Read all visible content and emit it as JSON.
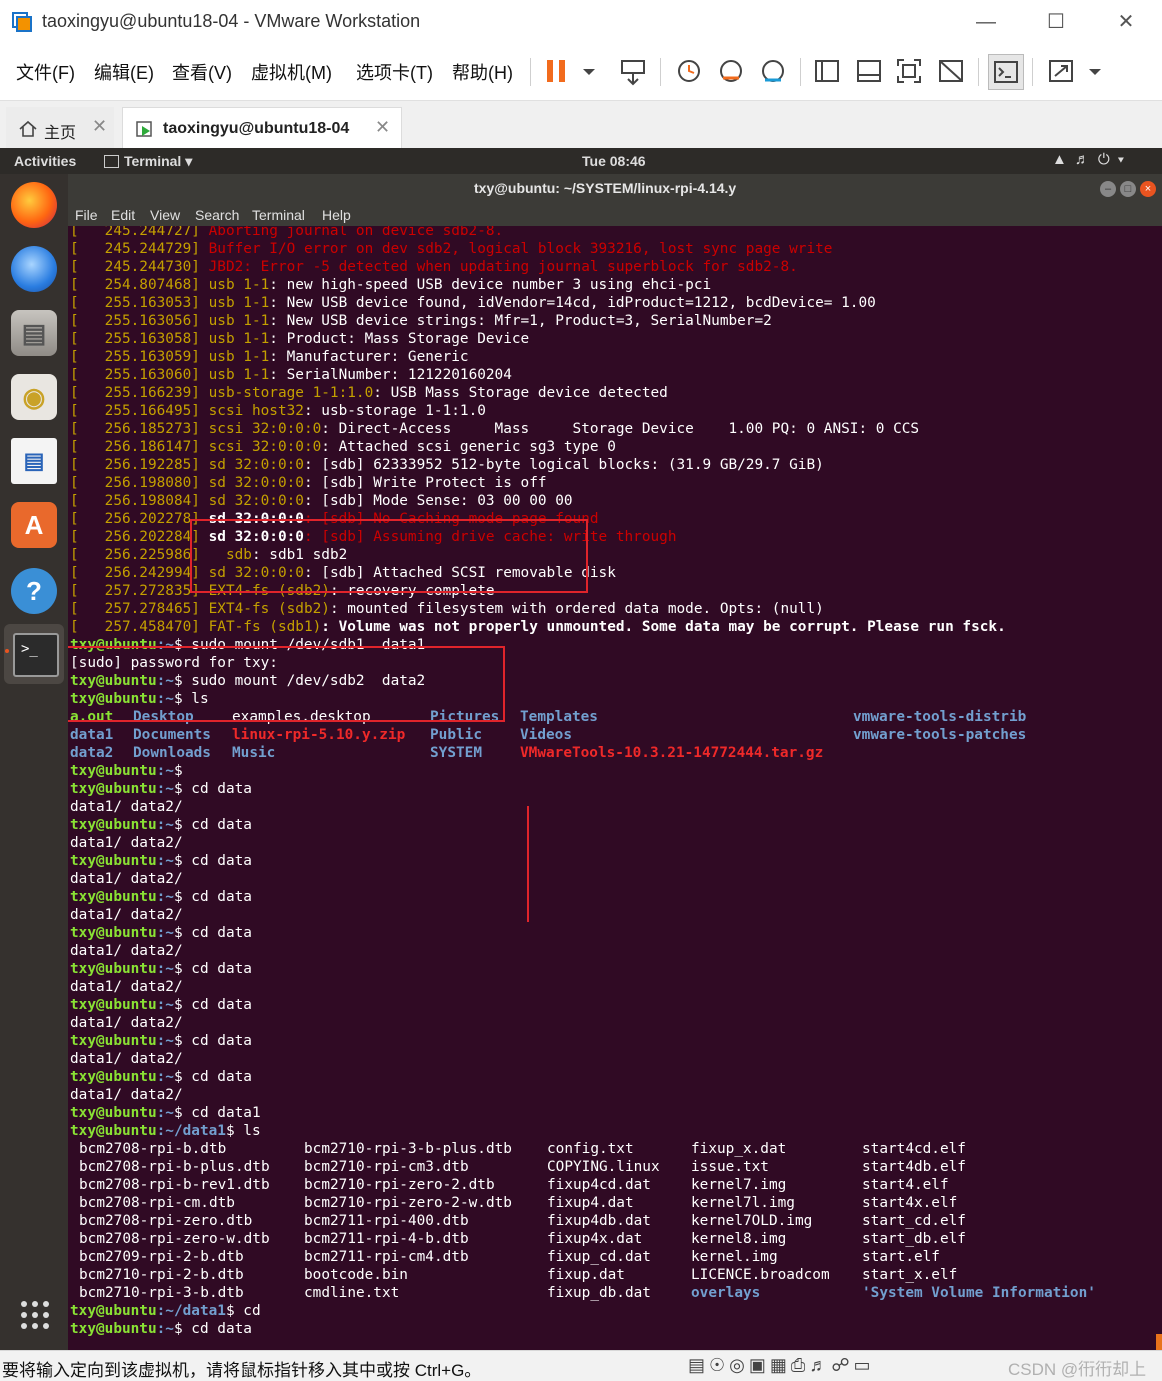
{
  "window": {
    "title": "taoxingyu@ubuntu18-04 - VMware Workstation"
  },
  "menubar": {
    "items": [
      "文件(F)",
      "编辑(E)",
      "查看(V)",
      "虚拟机(M)",
      "选项卡(T)",
      "帮助(H)"
    ]
  },
  "tabs": {
    "home": "主页",
    "vm": "taoxingyu@ubuntu18-04"
  },
  "ubuntu_bar": {
    "activities": "Activities",
    "app_menu": "Terminal ▾",
    "clock": "Tue 08:46"
  },
  "terminal": {
    "title": "txy@ubuntu: ~/SYSTEM/linux-rpi-4.14.y",
    "menu": [
      "File",
      "Edit",
      "View",
      "Search",
      "Terminal",
      "Help"
    ],
    "kernel_log": [
      {
        "ts": "[   245.244727]",
        "src": "Aborting journal on device sdb2-8.",
        "msg": "",
        "style": "red"
      },
      {
        "ts": "[   245.244729]",
        "src": "Buffer I/O error on dev sdb2, logical block 393216, lost sync page write",
        "msg": "",
        "style": "red"
      },
      {
        "ts": "[   245.244730]",
        "src": "JBD2: Error -5 detected when updating journal superblock for sdb2-8.",
        "msg": "",
        "style": "red"
      },
      {
        "ts": "[   254.807468]",
        "src": "usb 1-1",
        "msg": ": new high-speed USB device number 3 using ehci-pci",
        "style": "src"
      },
      {
        "ts": "[   255.163053]",
        "src": "usb 1-1",
        "msg": ": New USB device found, idVendor=14cd, idProduct=1212, bcdDevice= 1.00",
        "style": "src"
      },
      {
        "ts": "[   255.163056]",
        "src": "usb 1-1",
        "msg": ": New USB device strings: Mfr=1, Product=3, SerialNumber=2",
        "style": "src"
      },
      {
        "ts": "[   255.163058]",
        "src": "usb 1-1",
        "msg": ": Product: Mass Storage Device",
        "style": "src"
      },
      {
        "ts": "[   255.163059]",
        "src": "usb 1-1",
        "msg": ": Manufacturer: Generic",
        "style": "src"
      },
      {
        "ts": "[   255.163060]",
        "src": "usb 1-1",
        "msg": ": SerialNumber: 121220160204",
        "style": "src"
      },
      {
        "ts": "[   255.166239]",
        "src": "usb-storage 1-1:1.0",
        "msg": ": USB Mass Storage device detected",
        "style": "src"
      },
      {
        "ts": "[   255.166495]",
        "src": "scsi host32",
        "msg": ": usb-storage 1-1:1.0",
        "style": "src"
      },
      {
        "ts": "[   256.185273]",
        "src": "scsi 32:0:0:0",
        "msg": ": Direct-Access     Mass     Storage Device    1.00 PQ: 0 ANSI: 0 CCS",
        "style": "src"
      },
      {
        "ts": "[   256.186147]",
        "src": "scsi 32:0:0:0",
        "msg": ": Attached scsi generic sg3 type 0",
        "style": "src"
      },
      {
        "ts": "[   256.192285]",
        "src": "sd 32:0:0:0",
        "msg": ": [sdb] 62333952 512-byte logical blocks: (31.9 GB/29.7 GiB)",
        "style": "src"
      },
      {
        "ts": "[   256.198080]",
        "src": "sd 32:0:0:0",
        "msg": ": [sdb] Write Protect is off",
        "style": "src"
      },
      {
        "ts": "[   256.198084]",
        "src": "sd 32:0:0:0",
        "msg": ": [sdb] Mode Sense: 03 00 00 00",
        "style": "src"
      },
      {
        "ts": "[   256.202278]",
        "src": "sd 32:0:0:0",
        "msg": ": [sdb] No Caching mode page found",
        "style": "srcred"
      },
      {
        "ts": "[   256.202284]",
        "src": "sd 32:0:0:0",
        "msg": ": [sdb] Assuming drive cache: write through",
        "style": "srcred"
      },
      {
        "ts": "[   256.225986]",
        "src": "  sdb",
        "msg": ": sdb1 sdb2",
        "style": "src"
      },
      {
        "ts": "[   256.242994]",
        "src": "sd 32:0:0:0",
        "msg": ": [sdb] Attached SCSI removable disk",
        "style": "src"
      },
      {
        "ts": "[   257.272835]",
        "src": "EXT4-fs (sdb2)",
        "msg": ": recovery complete",
        "style": "src"
      },
      {
        "ts": "[   257.278465]",
        "src": "EXT4-fs (sdb2)",
        "msg": ": mounted filesystem with ordered data mode. Opts: (null)",
        "style": "src"
      },
      {
        "ts": "[   257.458470]",
        "src": "FAT-fs (sdb1)",
        "msg": ": Volume was not properly unmounted. Some data may be corrupt. Please run fsck.",
        "style": "srcbold"
      }
    ],
    "prompt_user": "txy@ubuntu",
    "session": [
      {
        "dir": ":~",
        "cmd": "$ sudo mount /dev/sdb1  data1"
      },
      {
        "plain": "[sudo] password for txy:"
      },
      {
        "dir": ":~",
        "cmd": "$ sudo mount /dev/sdb2  data2"
      },
      {
        "dir": ":~",
        "cmd": "$ ls"
      }
    ],
    "ls_home": [
      [
        {
          "t": "a.out",
          "c": "grn"
        },
        {
          "t": "Desktop",
          "c": "blu"
        },
        {
          "t": "examples.desktop",
          "c": ""
        },
        {
          "t": "Pictures",
          "c": "blu"
        },
        {
          "t": "Templates",
          "c": "blu"
        },
        {
          "t": "vmware-tools-distrib",
          "c": "blu"
        }
      ],
      [
        {
          "t": "data1",
          "c": "blu"
        },
        {
          "t": "Documents",
          "c": "blu"
        },
        {
          "t": "linux-rpi-5.10.y.zip",
          "c": "redb"
        },
        {
          "t": "Public",
          "c": "blu"
        },
        {
          "t": "Videos",
          "c": "blu"
        },
        {
          "t": "vmware-tools-patches",
          "c": "blu"
        }
      ],
      [
        {
          "t": "data2",
          "c": "blu"
        },
        {
          "t": "Downloads",
          "c": "blu"
        },
        {
          "t": "Music",
          "c": "blu"
        },
        {
          "t": "SYSTEM",
          "c": "blu"
        },
        {
          "t": "VMwareTools-10.3.21-14772444.tar.gz",
          "c": "redb"
        },
        {
          "t": "",
          "c": ""
        }
      ]
    ],
    "cd_lines": {
      "cmd": "$ cd data",
      "completion": "data1/ data2/",
      "repeat": 9,
      "cd_data1": "$ cd data1",
      "data1_dir": ":~/data1",
      "ls": "$ ls",
      "cd": "$ cd",
      "last": "$ cd data"
    },
    "ls_data1": [
      [
        "bcm2708-rpi-b.dtb",
        "bcm2708-rpi-b-plus.dtb",
        "bcm2708-rpi-b-rev1.dtb",
        "bcm2708-rpi-cm.dtb",
        "bcm2708-rpi-zero.dtb",
        "bcm2708-rpi-zero-w.dtb",
        "bcm2709-rpi-2-b.dtb",
        "bcm2710-rpi-2-b.dtb",
        "bcm2710-rpi-3-b.dtb"
      ],
      [
        "bcm2710-rpi-3-b-plus.dtb",
        "bcm2710-rpi-cm3.dtb",
        "bcm2710-rpi-zero-2.dtb",
        "bcm2710-rpi-zero-2-w.dtb",
        "bcm2711-rpi-400.dtb",
        "bcm2711-rpi-4-b.dtb",
        "bcm2711-rpi-cm4.dtb",
        "bootcode.bin",
        "cmdline.txt"
      ],
      [
        "config.txt",
        "COPYING.linux",
        "fixup4cd.dat",
        "fixup4.dat",
        "fixup4db.dat",
        "fixup4x.dat",
        "fixup_cd.dat",
        "fixup.dat",
        "fixup_db.dat"
      ],
      [
        "fixup_x.dat",
        "issue.txt",
        "kernel7.img",
        "kernel7l.img",
        "kernel7OLD.img",
        "kernel8.img",
        "kernel.img",
        "LICENCE.broadcom",
        "overlays"
      ],
      [
        "start4cd.elf",
        "start4db.elf",
        "start4.elf",
        "start4x.elf",
        "start_cd.elf",
        "start_db.elf",
        "start.elf",
        "start_x.elf",
        "'System Volume Information'"
      ]
    ]
  },
  "statusbar": {
    "message": "要将输入定向到该虚拟机，请将鼠标指针移入其中或按 Ctrl+G。",
    "watermark": "CSDN @衎衎却上"
  },
  "colors": {
    "terminal_bg": "#300a24",
    "prompt": "#8ae234",
    "dir": "#729fcf",
    "error": "#cc0000",
    "annotation": "#e0242b"
  }
}
